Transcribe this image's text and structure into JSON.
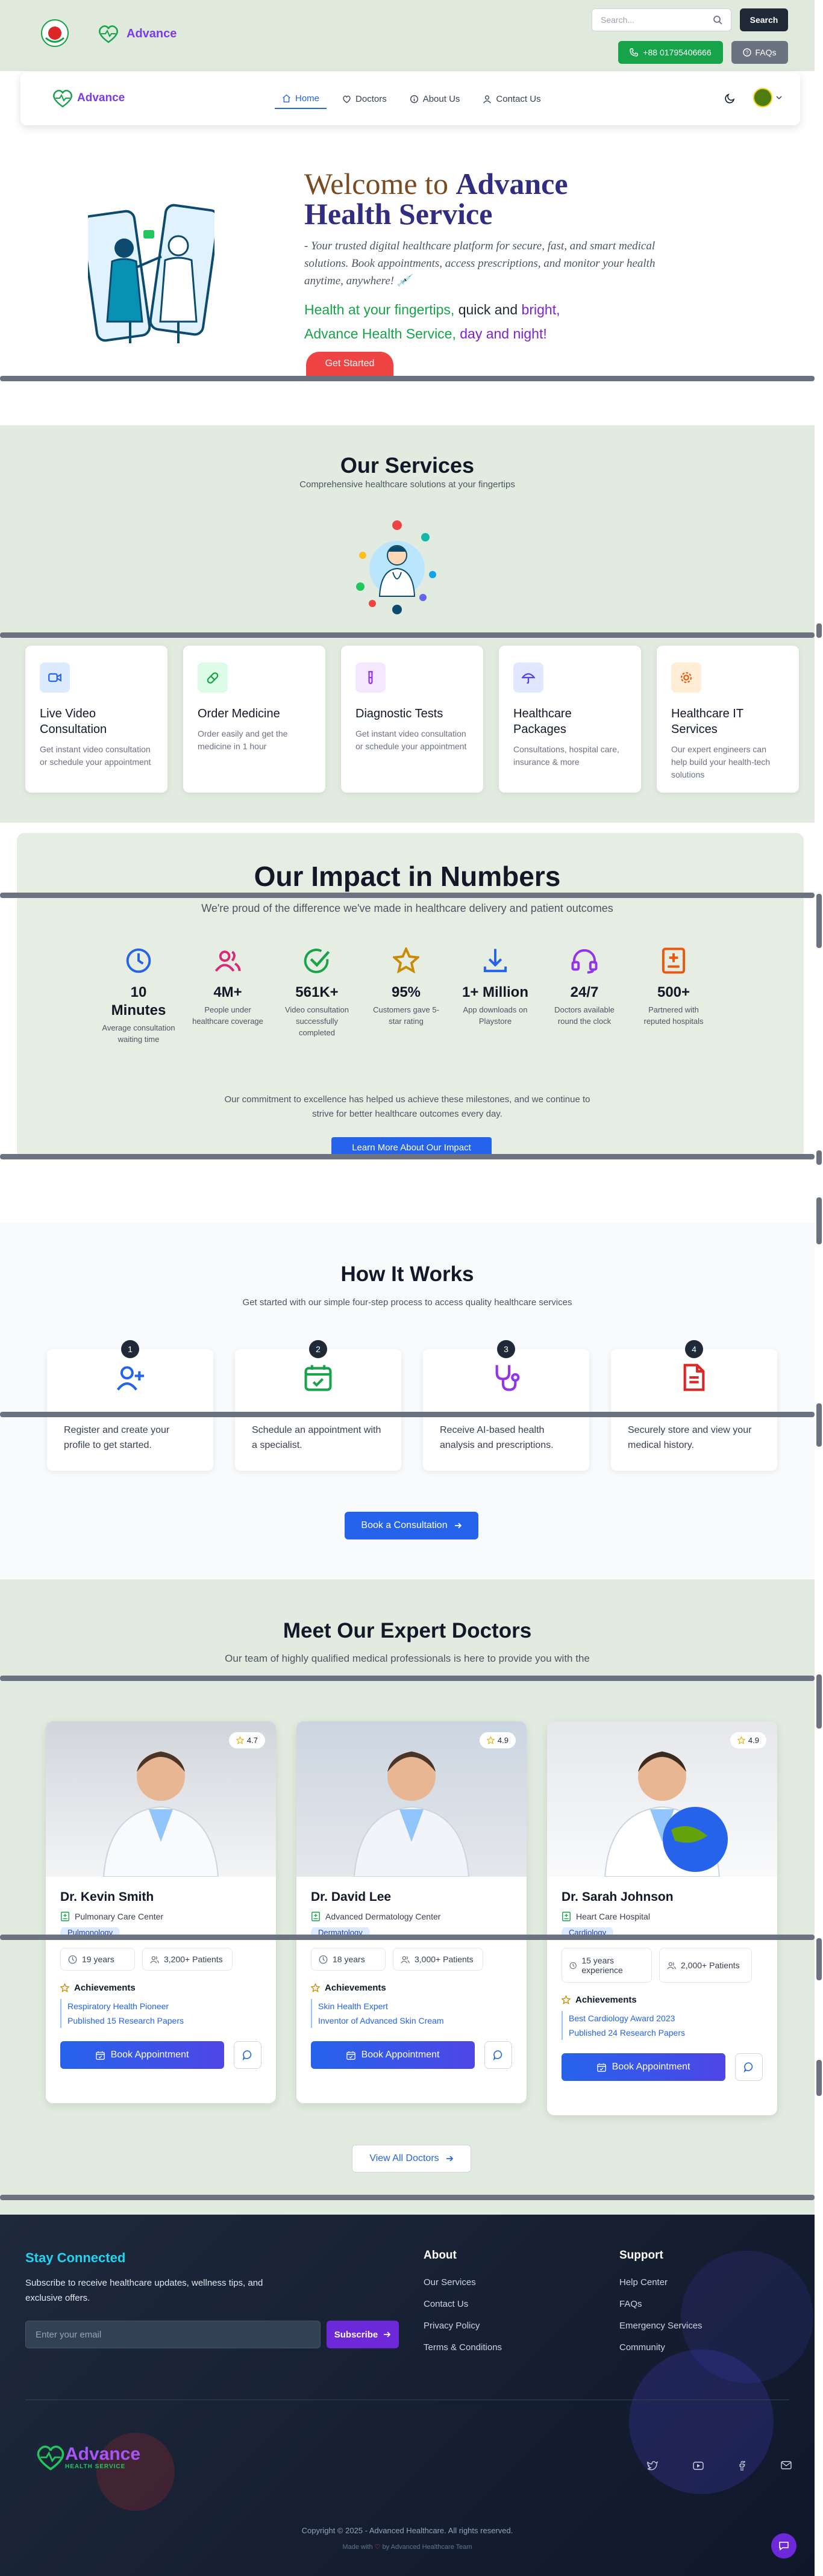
{
  "topbar": {
    "search_placeholder": "Search...",
    "search_button": "Search",
    "phone": "+88 01795406666",
    "faqs": "FAQs",
    "logo_text": "Advance"
  },
  "nav": {
    "logo_text": "Advance",
    "items": [
      {
        "label": "Home",
        "icon": "home-icon",
        "active": true
      },
      {
        "label": "Doctors",
        "icon": "heart-icon"
      },
      {
        "label": "About Us",
        "icon": "info-icon"
      },
      {
        "label": "Contact Us",
        "icon": "user-icon"
      }
    ]
  },
  "hero": {
    "title_part1": "Welcome to",
    "title_part2": "Advance",
    "title_part3": "Health Service",
    "subtitle": "- Your trusted digital healthcare platform for secure, fast, and smart medical solutions. Book appointments, access prescriptions, and monitor your health anytime, anywhere! 💉",
    "tag_a": "Health at your fingertips,",
    "tag_b": "quick and",
    "tag_c": "bright,",
    "tag_d": "Advance Health Service,",
    "tag_e": "day and night!",
    "cta": "Get Started"
  },
  "services": {
    "title": "Our Services",
    "subtitle": "Comprehensive healthcare solutions at your fingertips",
    "cards": [
      {
        "title": "Live Video Consultation",
        "desc": "Get instant video consultation or schedule your appointment",
        "icon": "video-icon",
        "color": "#2563eb",
        "bg": "#dbeafe"
      },
      {
        "title": "Order Medicine",
        "desc": "Order easily and get the medicine in 1 hour",
        "icon": "pill-icon",
        "color": "#16a34a",
        "bg": "#dcfce7"
      },
      {
        "title": "Diagnostic Tests",
        "desc": "Get instant video consultation or schedule your appointment",
        "icon": "test-tube-icon",
        "color": "#9333ea",
        "bg": "#f3e8ff"
      },
      {
        "title": "Healthcare Packages",
        "desc": "Consultations, hospital care, insurance & more",
        "icon": "umbrella-icon",
        "color": "#4f46e5",
        "bg": "#e0e7ff"
      },
      {
        "title": "Healthcare IT Services",
        "desc": "Our expert engineers can help build your health-tech solutions",
        "icon": "gear-icon",
        "color": "#ea580c",
        "bg": "#ffedd5"
      }
    ]
  },
  "impact": {
    "title": "Our Impact in Numbers",
    "subtitle": "We're proud of the difference we've made in healthcare delivery and patient outcomes",
    "stats": [
      {
        "num": "10 Minutes",
        "label": "Average consultation waiting time",
        "icon": "clock-icon",
        "color": "#2563eb"
      },
      {
        "num": "4M+",
        "label": "People under healthcare coverage",
        "icon": "users-icon",
        "color": "#db2777"
      },
      {
        "num": "561K+",
        "label": "Video consultation successfully completed",
        "icon": "check-circle-icon",
        "color": "#16a34a"
      },
      {
        "num": "95%",
        "label": "Customers gave 5-star rating",
        "icon": "star-icon",
        "color": "#ca8a04"
      },
      {
        "num": "1+ Million",
        "label": "App downloads on Playstore",
        "icon": "download-icon",
        "color": "#2563eb"
      },
      {
        "num": "24/7",
        "label": "Doctors available round the clock",
        "icon": "headset-icon",
        "color": "#9333ea"
      },
      {
        "num": "500+",
        "label": "Partnered with reputed hospitals",
        "icon": "hospital-icon",
        "color": "#ea580c"
      }
    ],
    "commitment": "Our commitment to excellence has helped us achieve these milestones, and we continue to strive for better healthcare outcomes every day.",
    "cta": "Learn More About Our Impact"
  },
  "how": {
    "title": "How It Works",
    "subtitle": "Get started with our simple four-step process to access quality healthcare services",
    "steps": [
      {
        "num": "1",
        "desc": "Register and create your profile to get started.",
        "icon": "user-plus-icon",
        "color": "#2563eb"
      },
      {
        "num": "2",
        "desc": "Schedule an appointment with a specialist.",
        "icon": "calendar-icon",
        "color": "#16a34a"
      },
      {
        "num": "3",
        "desc": "Receive AI-based health analysis and prescriptions.",
        "icon": "stethoscope-icon",
        "color": "#9333ea"
      },
      {
        "num": "4",
        "desc": "Securely store and view your medical history.",
        "icon": "file-icon",
        "color": "#dc2626"
      }
    ],
    "cta": "Book a Consultation"
  },
  "doctors": {
    "title": "Meet Our Expert Doctors",
    "subtitle": "Our team of highly qualified medical professionals is here to provide you with the",
    "list": [
      {
        "name": "Dr. Kevin Smith",
        "hospital": "Pulmonary Care Center",
        "specialty": "Pulmonology",
        "rating": "4.7",
        "experience": "19 years",
        "patients": "3,200+ Patients",
        "achievements_label": "Achievements",
        "achievements": [
          "Respiratory Health Pioneer",
          "Published 15 Research Papers"
        ],
        "book": "Book Appointment"
      },
      {
        "name": "Dr. David Lee",
        "hospital": "Advanced Dermatology Center",
        "specialty": "Dermatology",
        "rating": "4.9",
        "experience": "18 years",
        "patients": "3,000+ Patients",
        "achievements_label": "Achievements",
        "achievements": [
          "Skin Health Expert",
          "Inventor of Advanced Skin Cream"
        ],
        "book": "Book Appointment"
      },
      {
        "name": "Dr. Sarah Johnson",
        "hospital": "Heart Care Hospital",
        "specialty": "Cardiology",
        "rating": "4.9",
        "experience": "15 years experience",
        "patients": "2,000+ Patients",
        "achievements_label": "Achievements",
        "achievements": [
          "Best Cardiology Award 2023",
          "Published 24 Research Papers"
        ],
        "book": "Book Appointment"
      }
    ],
    "view_all": "View All Doctors"
  },
  "footer": {
    "stay_title": "Stay Connected",
    "stay_desc": "Subscribe to receive healthcare updates, wellness tips, and exclusive offers.",
    "email_placeholder": "Enter your email",
    "subscribe": "Subscribe",
    "about_title": "About",
    "about_links": [
      "Our Services",
      "Contact Us",
      "Privacy Policy",
      "Terms & Conditions"
    ],
    "support_title": "Support",
    "support_links": [
      "Help Center",
      "FAQs",
      "Emergency Services",
      "Community"
    ],
    "logo_text": "Advance",
    "logo_sub": "HEALTH SERVICE",
    "copyright": "Copyright © 2025 - Advanced Healthcare. All rights reserved.",
    "made_with_a": "Made with",
    "made_with_b": "by Advanced Healthcare Team"
  }
}
